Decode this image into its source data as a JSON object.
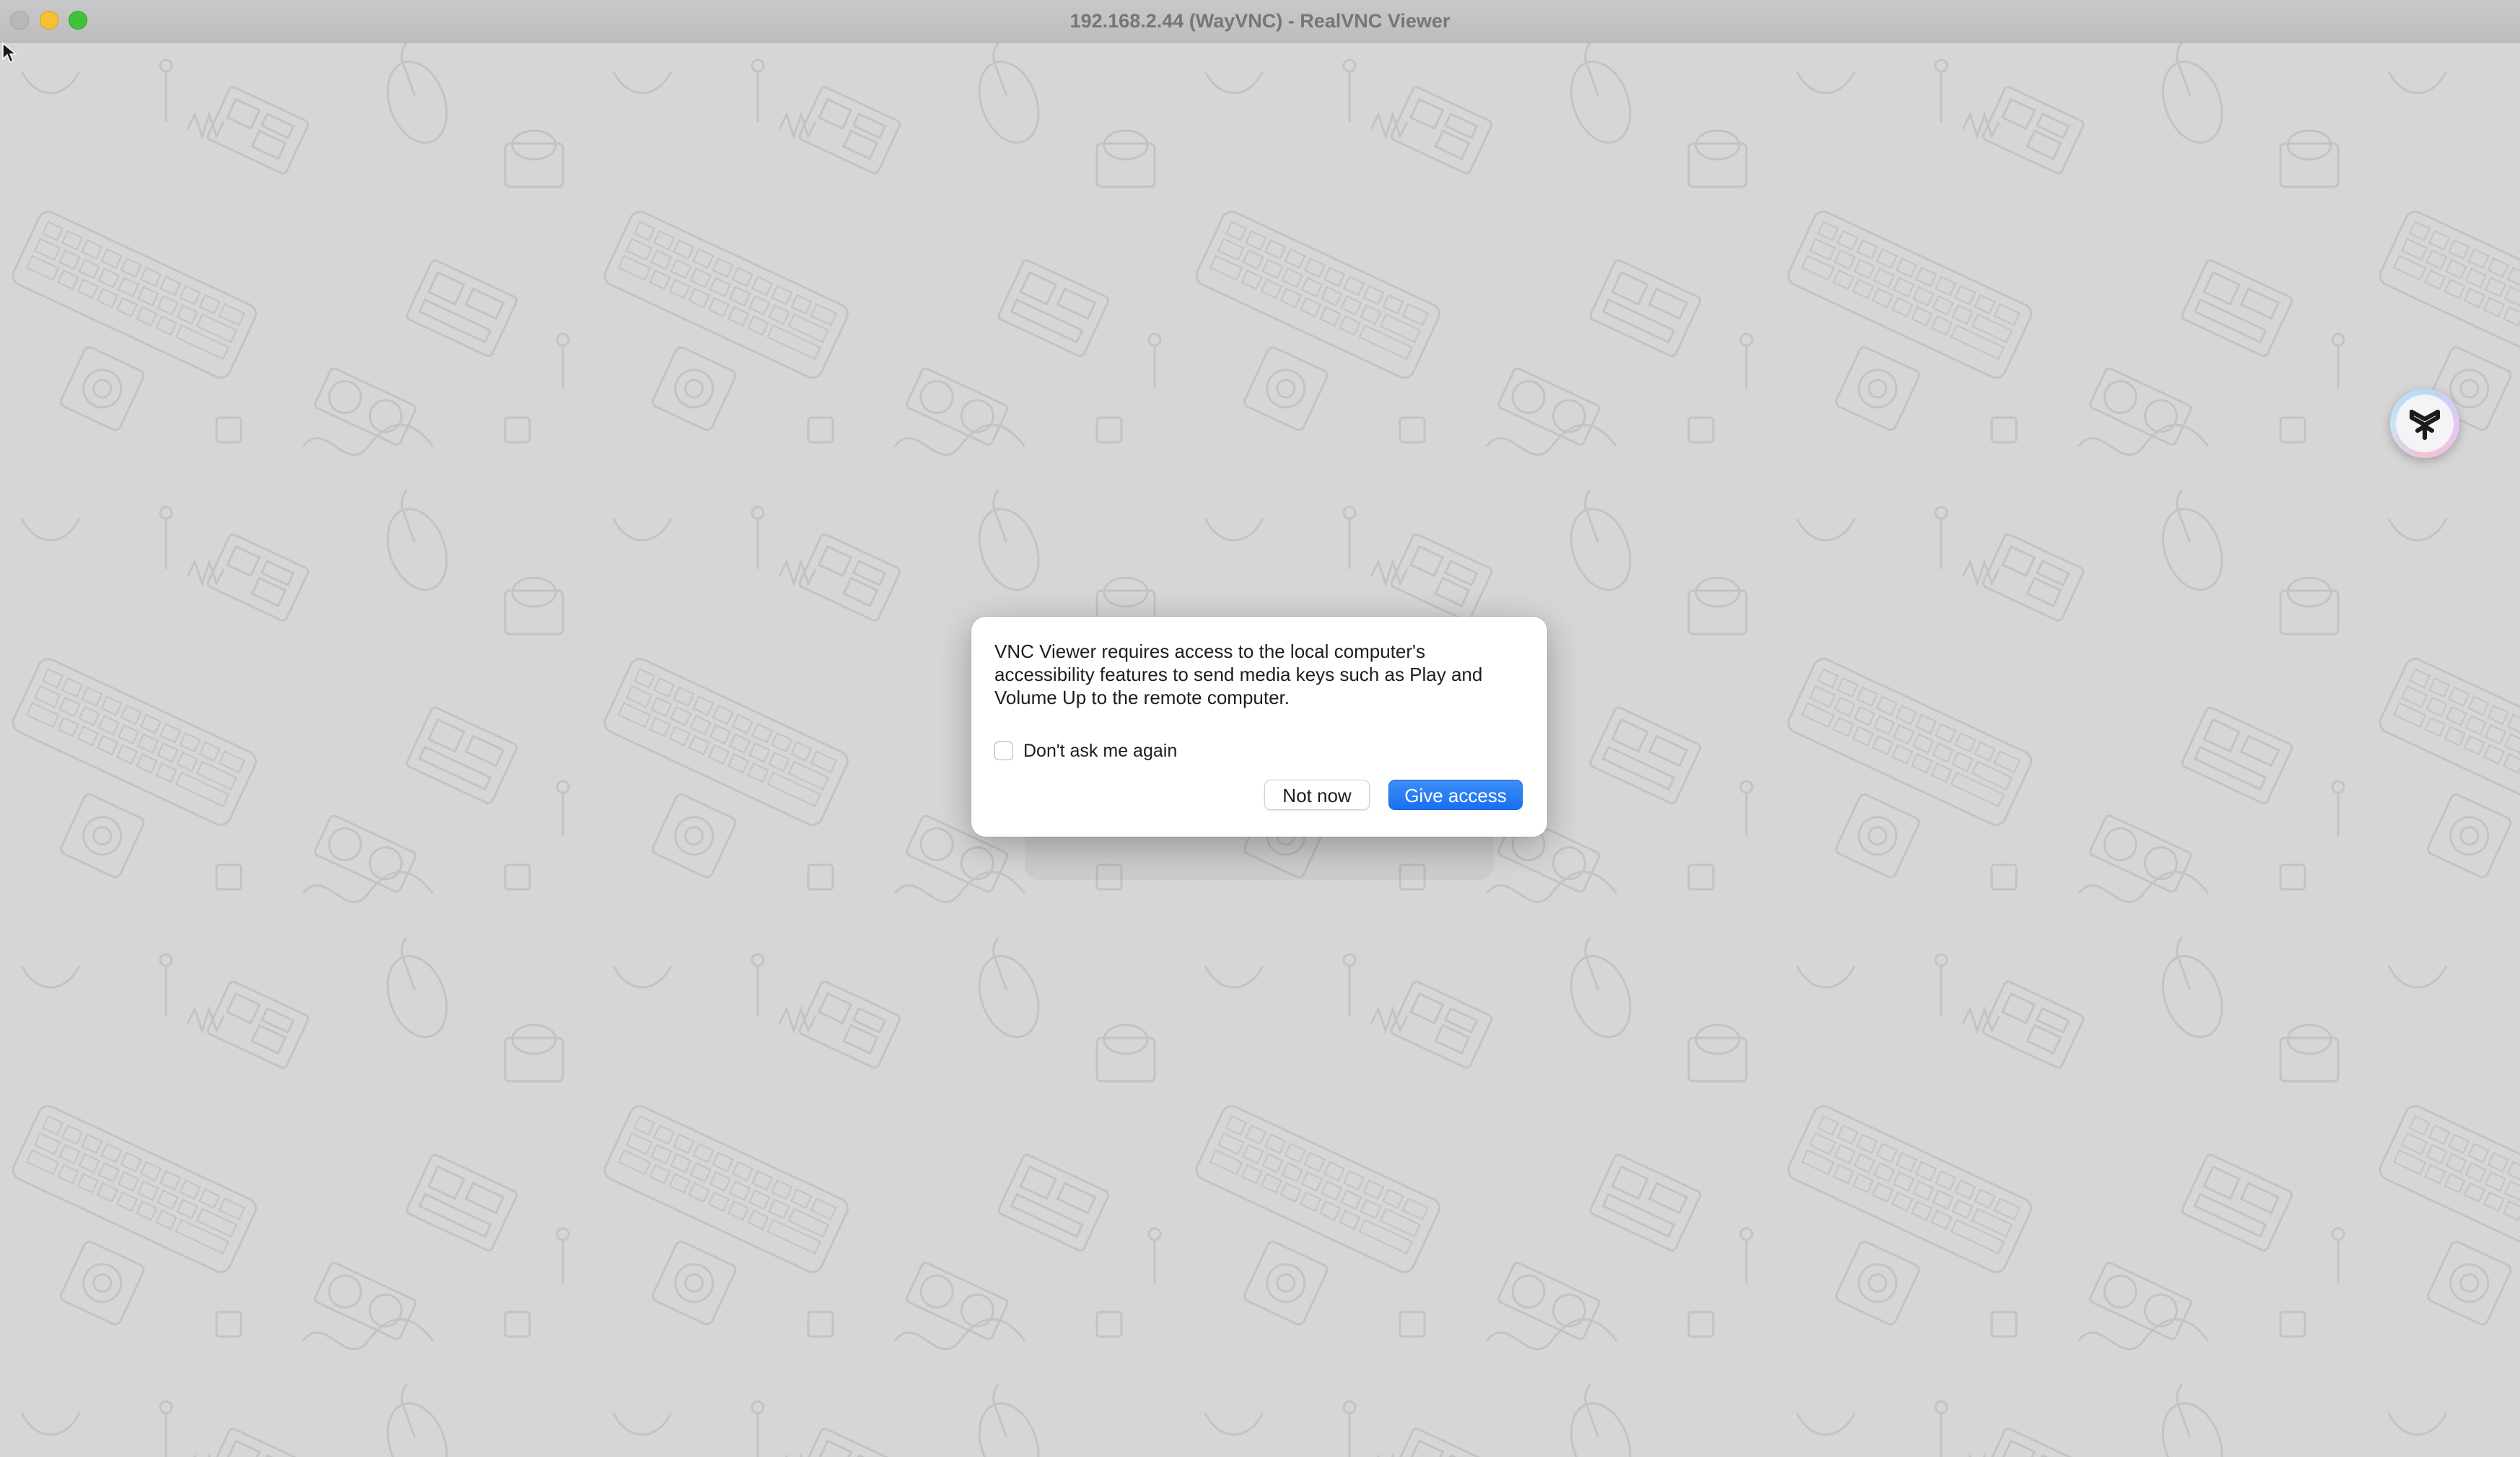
{
  "window": {
    "title": "192.168.2.44 (WayVNC) - RealVNC Viewer"
  },
  "dialog": {
    "message": "VNC Viewer requires access to the local computer's accessibility features to send media keys such as Play and Volume Up to the remote computer.",
    "checkbox_label": "Don't ask me again",
    "checkbox_checked": false,
    "secondary_button": "Not now",
    "primary_button": "Give access"
  },
  "icons": {
    "cursor": "arrow-cursor-icon",
    "widget": "y-logo-icon"
  },
  "colors": {
    "accent": "#1a6ff0",
    "background": "#d6d6d6",
    "titlebar": "#c4c4c4"
  }
}
